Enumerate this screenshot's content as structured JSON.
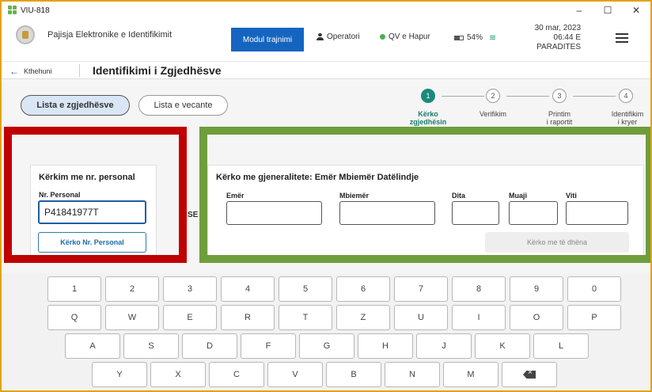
{
  "window": {
    "title": "VIU-818",
    "buttons": [
      "–",
      "☐",
      "✕"
    ]
  },
  "appbar": {
    "app_name": "Pajisja Elektronike e Identifikimit",
    "modul_button": "Modul trajnimi",
    "operator": "Operatori",
    "status": "QV e Hapur",
    "battery": "54%",
    "date": "30 mar, 2023",
    "time": "06:44 E PARADITES",
    "status_color": "#4caf50",
    "accent": "#1565c0"
  },
  "subbar": {
    "back_label": "Kthehuni",
    "page_title": "Identifikimi i Zgjedhësve"
  },
  "tabs": [
    {
      "label": "Lista e zgjedhësve",
      "active": true
    },
    {
      "label": "Lista e vecante",
      "active": false
    }
  ],
  "stepper": {
    "steps": [
      {
        "number": "1",
        "label_line1": "Kërko",
        "label_line2": "zgjedhësin",
        "active": true
      },
      {
        "number": "2",
        "label_line1": "Verifikim",
        "label_line2": "",
        "active": false
      },
      {
        "number": "3",
        "label_line1": "Printim",
        "label_line2": "i raportit",
        "active": false
      },
      {
        "number": "4",
        "label_line1": "Identifikim",
        "label_line2": "i kryer",
        "active": false
      }
    ]
  },
  "personal_search": {
    "title": "Kërkim me nr. personal",
    "field_label": "Nr. Personal",
    "value": "P41841977T",
    "button": "Kërko Nr. Personal"
  },
  "or_fragment": "SE",
  "general_search": {
    "title": "Kërko me gjeneralitete: Emër Mbiemër Datëlindje",
    "fields": [
      {
        "label": "Emër",
        "value": ""
      },
      {
        "label": "Mbiemër",
        "value": ""
      },
      {
        "label": "Dita",
        "value": ""
      },
      {
        "label": "Muaji",
        "value": ""
      },
      {
        "label": "Viti",
        "value": ""
      }
    ],
    "button": "Kërko me të dhëna"
  },
  "highlights": {
    "left_color": "#c00000",
    "right_color": "#6e9e3c"
  },
  "keyboard": {
    "row1": [
      "1",
      "2",
      "3",
      "4",
      "5",
      "6",
      "7",
      "8",
      "9",
      "0"
    ],
    "row2": [
      "Q",
      "W",
      "E",
      "R",
      "T",
      "Z",
      "U",
      "I",
      "O",
      "P"
    ],
    "row3": [
      "A",
      "S",
      "D",
      "F",
      "G",
      "H",
      "J",
      "K",
      "L"
    ],
    "row4": [
      "Y",
      "X",
      "C",
      "V",
      "B",
      "N",
      "M"
    ],
    "backspace_icon": "backspace-icon"
  }
}
